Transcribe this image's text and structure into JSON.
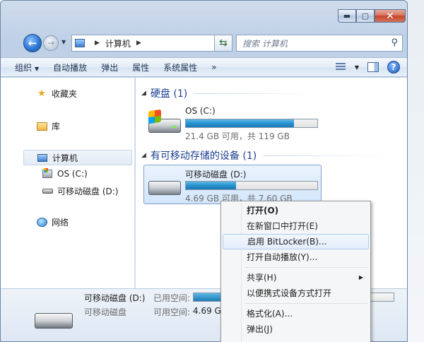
{
  "window": {
    "caption": {
      "minimize": "▬",
      "maximize": "▢",
      "close": "✕"
    }
  },
  "address": {
    "crumb": "计算机",
    "search_placeholder": "搜索 计算机"
  },
  "toolbar": {
    "organize": "组织",
    "autoplay": "自动播放",
    "eject": "弹出",
    "properties": "属性",
    "system_properties": "系统属性",
    "more": "»"
  },
  "nav": {
    "favorites": "收藏夹",
    "libraries": "库",
    "computer": "计算机",
    "drive_c": "OS (C:)",
    "drive_d": "可移动磁盘 (D:)",
    "network": "网络"
  },
  "content": {
    "hdd_group": "硬盘 (1)",
    "removable_group": "有可移动存储的设备 (1)",
    "drives": [
      {
        "name": "OS (C:)",
        "space": "21.4 GB 可用，共 119 GB",
        "used_fraction": 0.82
      },
      {
        "name": "可移动磁盘 (D:)",
        "space": "4.69 GB 可用，共 7.60 GB",
        "used_fraction": 0.38
      }
    ]
  },
  "details": {
    "name": "可移动磁盘 (D:)",
    "type": "可移动磁盘",
    "used_label": "已用空间:",
    "free_label": "可用空间:",
    "free_value": "4.69 GB",
    "used_fraction": 0.38
  },
  "context_menu": {
    "items": [
      {
        "label": "打开(O)",
        "bold": true
      },
      {
        "label": "在新窗口中打开(E)"
      },
      {
        "label": "启用 BitLocker(B)...",
        "hover": true
      },
      {
        "label": "打开自动播放(Y)..."
      },
      {
        "label": "共享(H)",
        "submenu": true,
        "sep_before": true
      },
      {
        "label": "以便携式设备方式打开"
      },
      {
        "label": "格式化(A)...",
        "sep_before": true
      },
      {
        "label": "弹出(J)"
      }
    ]
  },
  "icons": {
    "back": "back-arrow-icon",
    "forward": "forward-arrow-icon",
    "search": "search-icon",
    "help": "help-icon"
  }
}
